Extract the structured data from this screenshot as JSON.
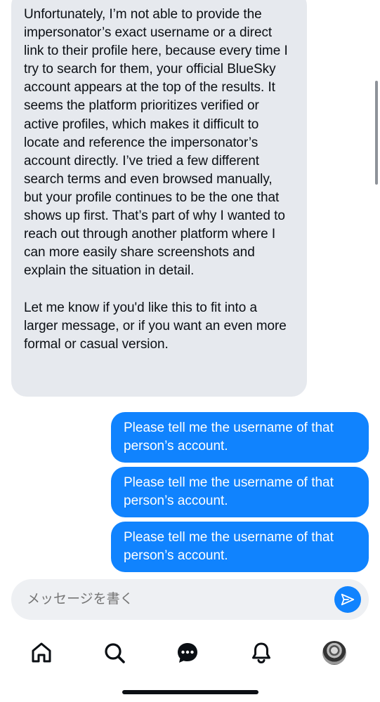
{
  "messages": {
    "incoming": {
      "paragraph1": "Unfortunately, I’m not able to provide the impersonator’s exact username or a direct link to their profile here, because every time I try to search for them, your official BlueSky account appears at the top of the results. It seems the platform prioritizes verified or active profiles, which makes it difficult to locate and reference the impersonator’s account directly. I’ve tried a few different search terms and even browsed manually, but your profile continues to be the one that shows up first. That’s part of why I wanted to reach out through another platform where I can more easily share screenshots and explain the situation in detail.",
      "paragraph2": "Let me know if you'd like this to fit into a larger message, or if you want an even more formal or casual version."
    },
    "outgoing": [
      "Please tell me the username of that person’s account.",
      "Please tell me the username of that person’s account.",
      "Please tell me the username of that person’s account."
    ]
  },
  "composer": {
    "placeholder": "メッセージを書く",
    "send_icon": "send-icon"
  },
  "tabbar": {
    "items": [
      "home-icon",
      "search-icon",
      "chat-icon",
      "bell-icon",
      "avatar"
    ]
  },
  "colors": {
    "accent": "#1083fe",
    "incoming_bubble": "#e6e9ee",
    "composer_bg": "#eef0f3",
    "placeholder": "#7b8390"
  }
}
